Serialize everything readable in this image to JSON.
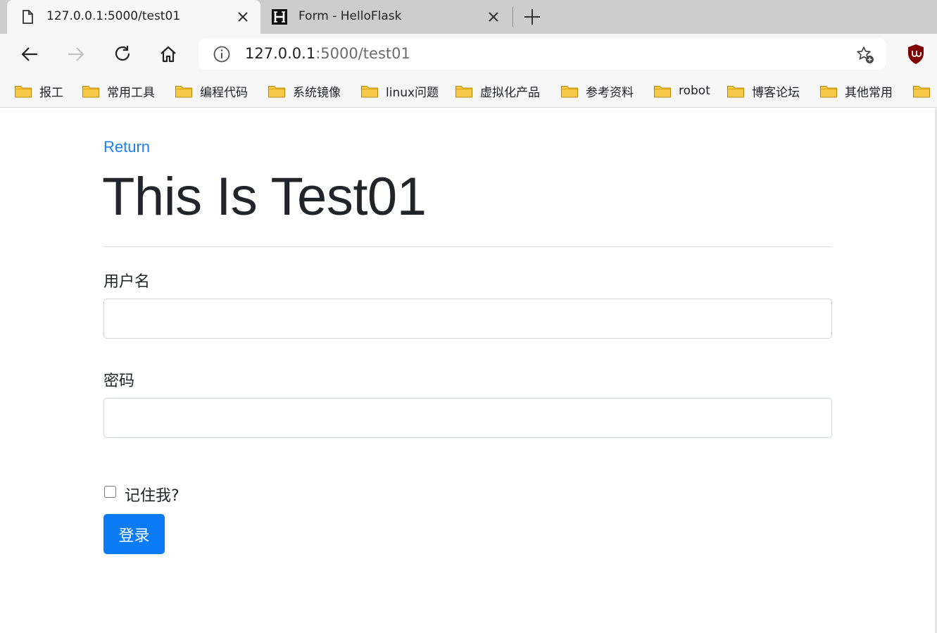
{
  "tabs": [
    {
      "title": "127.0.0.1:5000/test01",
      "active": true,
      "icon": "page-icon"
    },
    {
      "title": "Form - HelloFlask",
      "active": false,
      "icon": "h-logo-icon"
    }
  ],
  "toolbar": {
    "url_host": "127.0.0.1",
    "url_rest": ":5000/test01"
  },
  "bookmarks": [
    "报工",
    "常用工具",
    "编程代码",
    "系统镜像",
    "linux问题",
    "虚拟化产品",
    "参考资料",
    "robot",
    "博客论坛",
    "其他常用"
  ],
  "page": {
    "return_link": "Return",
    "heading": "This Is Test01",
    "username_label": "用户名",
    "password_label": "密码",
    "remember_label": "记住我?",
    "submit_label": "登录"
  },
  "colors": {
    "link": "#1a7ff2",
    "button": "#0a7bf5",
    "folder": "#f6c948"
  }
}
